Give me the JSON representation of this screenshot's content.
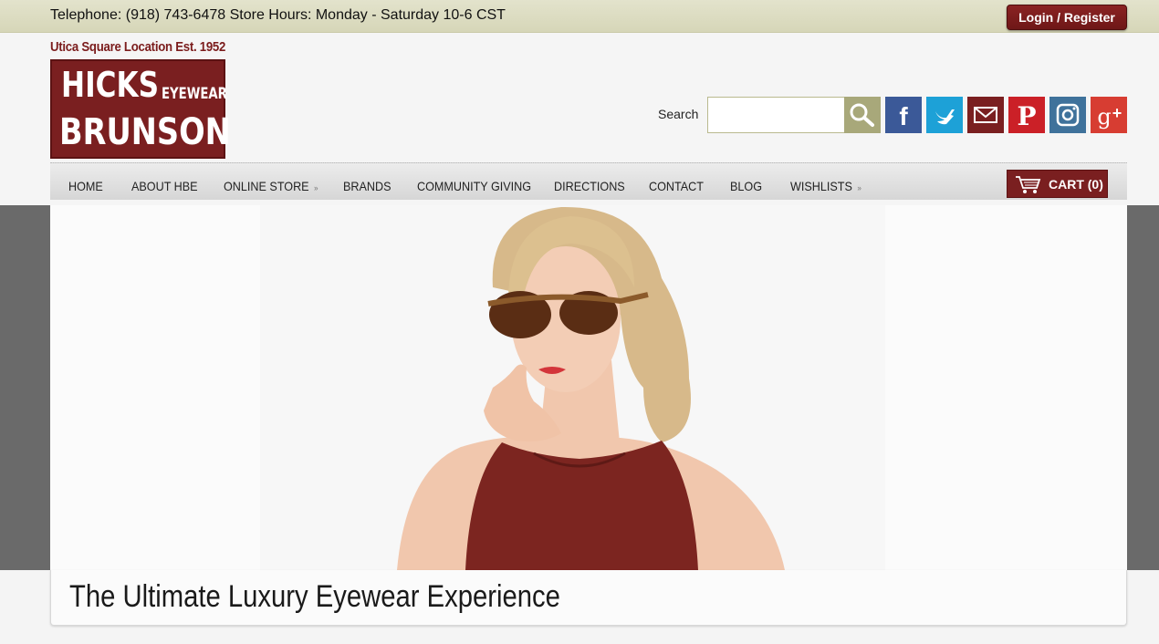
{
  "topbar": {
    "info": "Telephone: (918) 743-6478 Store Hours: Monday - Saturday 10-6 CST",
    "login_label": "Login / Register"
  },
  "header": {
    "est": "Utica Square Location Est. 1952",
    "logo_hicks": "HICKS",
    "logo_eyewear": "EYEWEAR",
    "logo_brunson": "BRUNSON",
    "search_label": "Search",
    "search_value": ""
  },
  "social": [
    {
      "name": "facebook-icon",
      "color": "#3b5998"
    },
    {
      "name": "twitter-icon",
      "color": "#1da1d7"
    },
    {
      "name": "email-icon",
      "color": "#7a1f20"
    },
    {
      "name": "pinterest-icon",
      "color": "#cb2027"
    },
    {
      "name": "instagram-icon",
      "color": "#3f729b"
    },
    {
      "name": "google-plus-icon",
      "color": "#d73d32"
    }
  ],
  "nav": {
    "items": [
      {
        "label": "HOME"
      },
      {
        "label": "ABOUT HBE"
      },
      {
        "label": "ONLINE STORE",
        "submenu": "»"
      },
      {
        "label": "BRANDS"
      },
      {
        "label": "COMMUNITY GIVING"
      },
      {
        "label": "DIRECTIONS"
      },
      {
        "label": "CONTACT"
      },
      {
        "label": "BLOG"
      },
      {
        "label": "WISHLISTS",
        "submenu": "»"
      }
    ],
    "cart_label": "CART (0)"
  },
  "hero": {
    "tagline": "The Ultimate Luxury Eyewear Experience"
  },
  "colors": {
    "brand": "#7a1f20",
    "topbar": "#dcdcc0",
    "search_button": "#a8a87a",
    "hero_side": "#6a6a6a"
  }
}
